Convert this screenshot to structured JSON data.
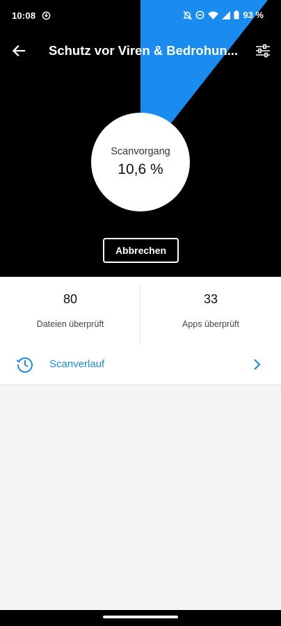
{
  "status_bar": {
    "time": "10:08",
    "battery": "93 %"
  },
  "header": {
    "title": "Schutz vor Viren & Bedrohun..."
  },
  "scan": {
    "label": "Scanvorgang",
    "progress_text": "10,6 %",
    "progress": 0.106,
    "cancel_label": "Abbrechen"
  },
  "stats": {
    "files": {
      "value": "80",
      "label": "Dateien überprüft"
    },
    "apps": {
      "value": "33",
      "label": "Apps überprüft"
    }
  },
  "history": {
    "label": "Scanverlauf"
  },
  "icons": {
    "back": "arrow-back-icon",
    "settings": "sliders-icon",
    "history": "history-clock-icon",
    "chevron": "chevron-right-icon"
  },
  "colors": {
    "accent": "#1e88e5",
    "wedge": "#1a8cf0",
    "hero_bg": "#000000",
    "page_bg": "#f5f5f5"
  }
}
